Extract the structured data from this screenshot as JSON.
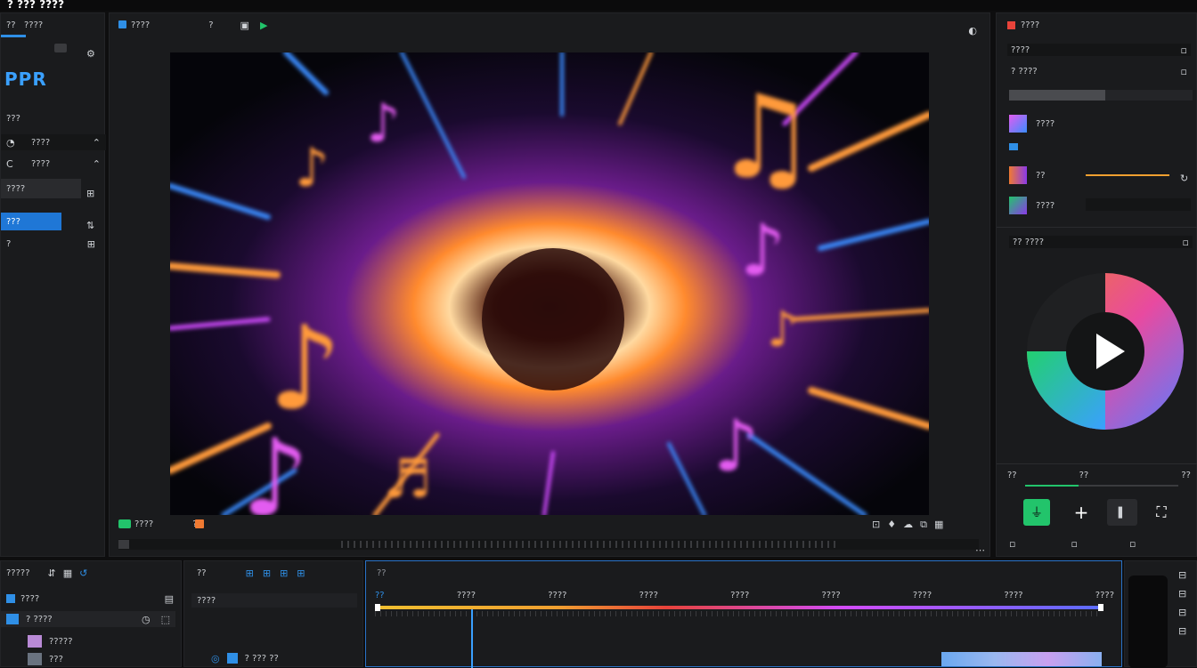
{
  "app": {
    "title": "? ??? ????",
    "logo": "PPR"
  },
  "left_panel": {
    "header": "????",
    "items": [
      {
        "label": "???",
        "icon": "star-icon"
      },
      {
        "label": "????",
        "icon": "chevron-icon"
      },
      {
        "label": "????",
        "icon": "chevron-icon"
      },
      {
        "label": "????",
        "icon": "grid-icon"
      },
      {
        "label": "???",
        "icon": "sort-icon",
        "active": true
      },
      {
        "label": "?",
        "icon": "grid-icon"
      }
    ]
  },
  "preview": {
    "top_label": "????",
    "tools": [
      "?",
      "??"
    ],
    "bottom_left_label": "????",
    "bottom_left_label2": "??",
    "play_icon": "play-icon"
  },
  "right_panel": {
    "header": "????",
    "section1_title": "????",
    "section1_row": "? ????",
    "effects": [
      {
        "label": "????"
      },
      {
        "label": "??"
      },
      {
        "label": "????"
      }
    ],
    "color_section": "?? ????",
    "tabs": [
      "??",
      "??",
      "??"
    ],
    "actions": [
      "add-effect",
      "add",
      "mask",
      "paint"
    ]
  },
  "bottom": {
    "left_header": "?????",
    "left_tab": "????",
    "left_row": "? ????",
    "left_items": [
      "?????",
      "???"
    ],
    "mid_header": "??",
    "mid_row": "????",
    "mid_footer": "? ??? ??",
    "timeline_label": "??",
    "ruler_labels": [
      "??",
      "????",
      "????",
      "????",
      "????",
      "????",
      "????",
      "????",
      "????",
      "????"
    ]
  },
  "colors": {
    "accent_blue": "#2f8fe6",
    "accent_green": "#22c46b",
    "accent_orange": "#f07a32",
    "panel_bg": "#1a1b1d"
  }
}
